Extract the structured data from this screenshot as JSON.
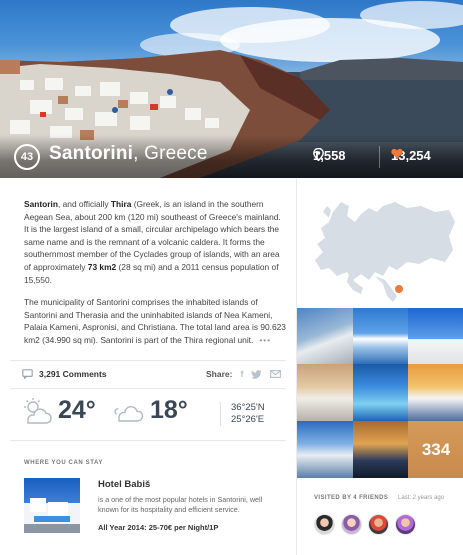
{
  "hero": {
    "badge": "43",
    "place_name": "Santorini",
    "place_country": ", Greece",
    "views": "1,558",
    "likes": "13,254"
  },
  "description": {
    "p1_name": "Santorin",
    "p1_a": ", and officially ",
    "p1_thira": "Thira",
    "p1_b": " (Greek, is an island in the southern Aegean Sea, about 200 km (120 mi) southeast of Greece's mainland. It is the largest island of a small, circular archipelago which bears the same name and is the remnant of a volcanic caldera. It forms the southernmost member of the Cyclades group of islands, with an area of approximately ",
    "p1_area": "73 km2",
    "p1_c": " (28 sq mi) and a 2011 census population of 15,550.",
    "p2": "The municipality of Santorini comprises the inhabited islands of Santorini and Therasia and the uninhabited islands of Nea Kameni, Palaia Kameni, Aspronisi, and Christiana. The total land area is 90.623 km2 (34.990 sq mi). Santorini is part of the Thira regional unit.",
    "more": "•••"
  },
  "social": {
    "comments": "3,291 Comments",
    "share_label": "Share:",
    "share_icons": [
      "facebook-icon",
      "twitter-icon",
      "email-icon"
    ]
  },
  "weather": {
    "day_temp": "24°",
    "night_temp": "18°",
    "lat": "36°25'N",
    "lon": "25°26'E"
  },
  "stay": {
    "section_title": "WHERE YOU CAN STAY",
    "hotel_name": "Hotel Babiš",
    "hotel_desc": "is a one of the most popular hotels in Santorini, well known for its hospitality and efficient service.",
    "hotel_price": "All Year 2014: 25-70€ per Night/1P"
  },
  "gallery": {
    "more_count": "334"
  },
  "friends": {
    "visited_label": "VISITED BY 4 FRIENDS",
    "last_visit": "Last: 2 years ago"
  },
  "colors": {
    "accent": "#f07a3c",
    "text_dark": "#3a4656"
  }
}
